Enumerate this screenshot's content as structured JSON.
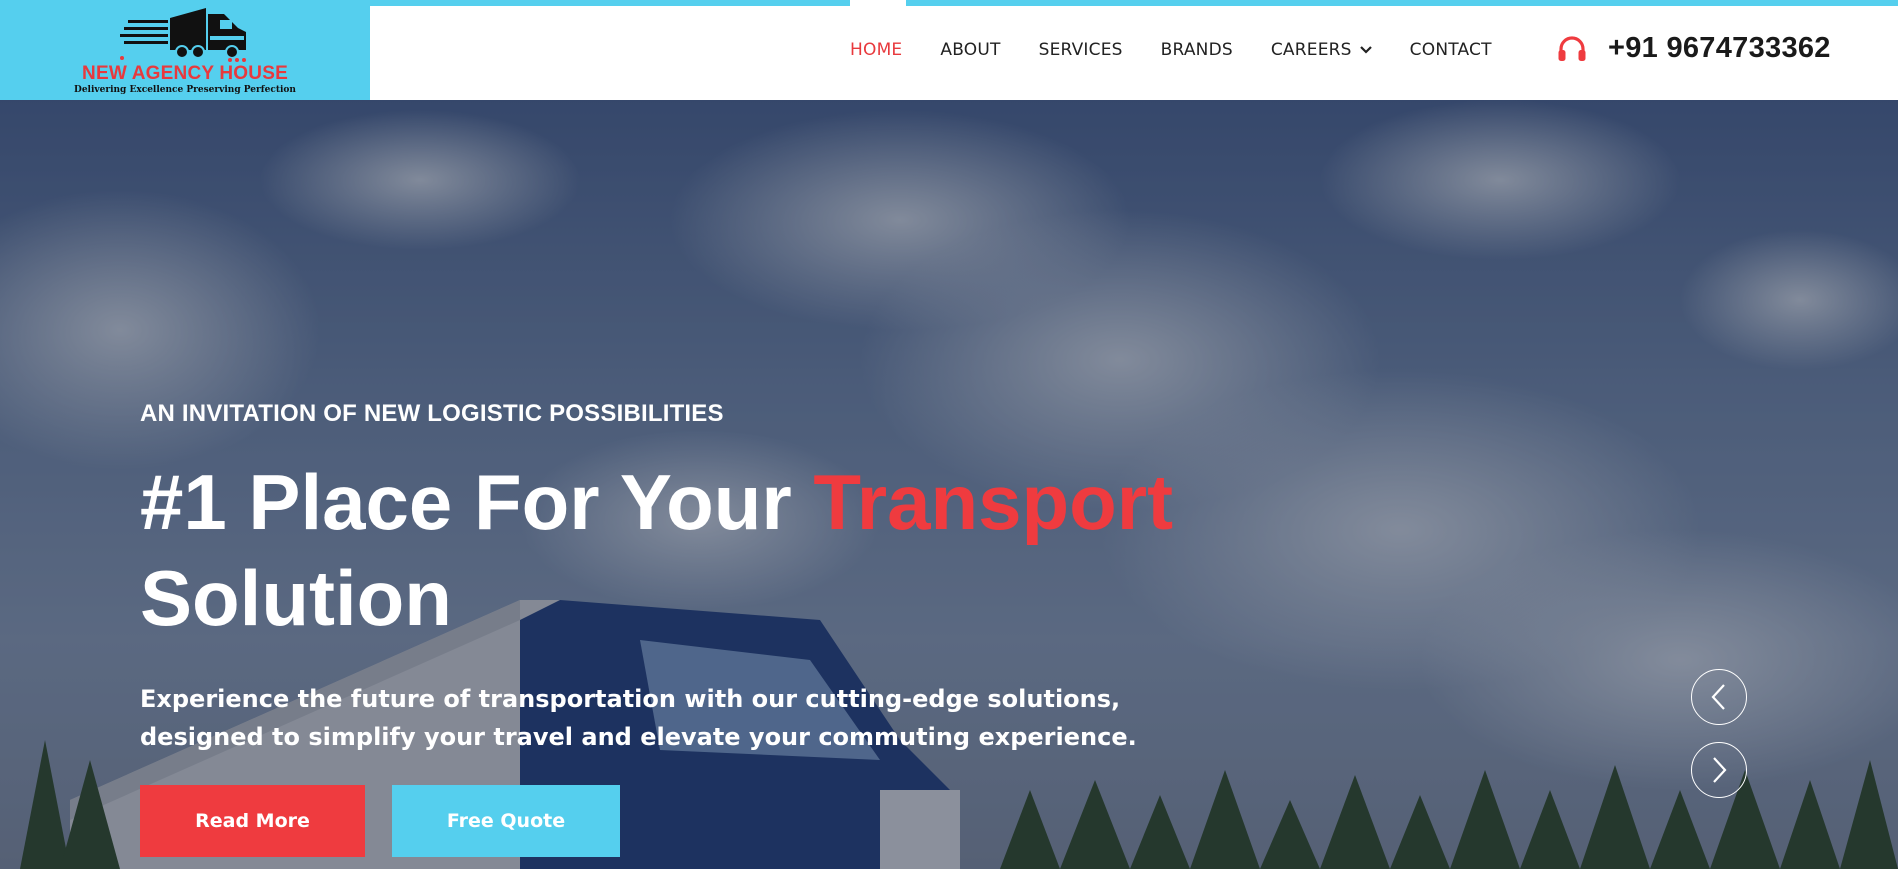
{
  "brand": {
    "name": "NEW AGENCY HOUSE",
    "tagline": "Delivering Excellence Preserving Perfection"
  },
  "nav": {
    "items": [
      {
        "label": "HOME",
        "active": true
      },
      {
        "label": "ABOUT"
      },
      {
        "label": "SERVICES"
      },
      {
        "label": "BRANDS"
      },
      {
        "label": "CAREERS",
        "has_dropdown": true
      },
      {
        "label": "CONTACT"
      }
    ]
  },
  "contact": {
    "phone": "+91 9674733362",
    "icon": "headset-icon"
  },
  "hero": {
    "eyebrow": "AN INVITATION OF NEW LOGISTIC POSSIBILITIES",
    "headline_part1": "#1 Place For Your",
    "headline_accent": "Transport",
    "headline_part2": "Solution",
    "description": "Experience the future of transportation with our cutting-edge solutions, designed to simplify your travel and elevate your commuting experience.",
    "buttons": {
      "primary": "Read More",
      "secondary": "Free Quote"
    },
    "slider": {
      "prev_icon": "chevron-left-icon",
      "next_icon": "chevron-right-icon"
    }
  },
  "colors": {
    "accent_red": "#ef3b3f",
    "accent_blue": "#55cfee",
    "nav_text": "#222222"
  }
}
